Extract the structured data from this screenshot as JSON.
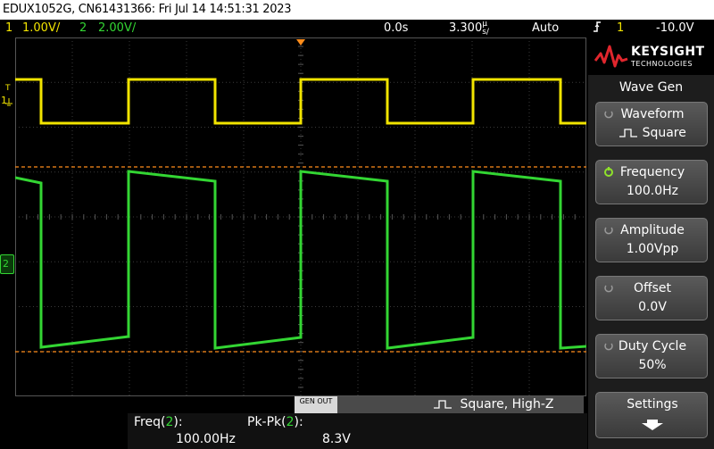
{
  "title_bar": {
    "text": "EDUX1052G, CN61431366: Fri Jul 14 14:51:31 2023"
  },
  "status_bar": {
    "ch1_num": "1",
    "ch1_scale": "1.00V/",
    "ch2_num": "2",
    "ch2_scale": "2.00V/",
    "time_delay": "0.0s",
    "time_scale": "3.300",
    "time_unit": "s/",
    "time_unit_prefix": "µ",
    "trigger_mode": "Auto",
    "trigger_icon": "rising-edge-icon",
    "trigger_ch": "1",
    "trigger_level": "-10.0V"
  },
  "markers": {
    "ch1": "1",
    "ch2": "2",
    "trigger": "T"
  },
  "logo": {
    "brand": "KEYSIGHT",
    "sub": "TECHNOLOGIES"
  },
  "side_panel": {
    "title": "Wave Gen",
    "softkeys": [
      {
        "label": "Waveform",
        "value": "Square"
      },
      {
        "label": "Frequency",
        "value": "100.0Hz"
      },
      {
        "label": "Amplitude",
        "value": "1.00Vpp"
      },
      {
        "label": "Offset",
        "value": "0.0V"
      },
      {
        "label": "Duty Cycle",
        "value": "50%"
      },
      {
        "label": "Settings",
        "value": ""
      }
    ]
  },
  "gen_bar": {
    "badge": "GEN OUT",
    "text": "Square, High-Z"
  },
  "measurements": {
    "freq_label": "Freq(",
    "freq_ch": "2",
    "freq_close": "):",
    "freq_value": "100.00Hz",
    "pkpk_label": "Pk-Pk(",
    "pkpk_ch": "2",
    "pkpk_close": "):",
    "pkpk_value": "8.3V"
  },
  "colors": {
    "ch1": "#f2e400",
    "ch2": "#33d633",
    "cursor": "#ff8c1a"
  }
}
